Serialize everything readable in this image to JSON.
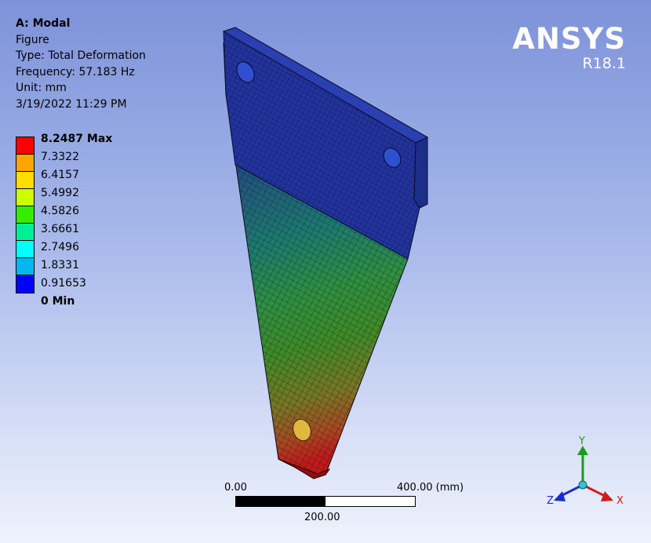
{
  "info": {
    "title": "A: Modal",
    "subtitle": "Figure",
    "type": "Type: Total Deformation",
    "frequency": "Frequency: 57.183 Hz",
    "unit": "Unit: mm",
    "timestamp": "3/19/2022 11:29 PM"
  },
  "legend": {
    "max_label": "8.2487 Max",
    "levels": [
      "7.3322",
      "6.4157",
      "5.4992",
      "4.5826",
      "3.6661",
      "2.7496",
      "1.8331",
      "0.91653"
    ],
    "min_label": "0 Min",
    "colors": [
      "#ff0000",
      "#ffa500",
      "#ffdd00",
      "#ccff00",
      "#33ee00",
      "#00ee99",
      "#00ffff",
      "#00b7ee",
      "#0000ff"
    ]
  },
  "brand": {
    "name": "ANSYS",
    "version": "R18.1"
  },
  "scale_bar": {
    "left_label": "0.00",
    "right_label": "400.00 (mm)",
    "mid_label": "200.00"
  },
  "triad": {
    "y_label": "Y",
    "x_label": "X",
    "z_label": "Z"
  }
}
